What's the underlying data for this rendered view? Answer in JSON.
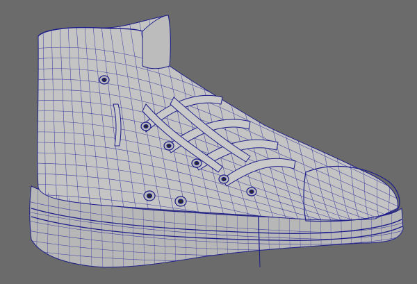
{
  "viewport": {
    "corner_label": "",
    "background_color": "#6b6b6b",
    "model": {
      "name": "sneaker-mesh",
      "shading": "wireframe-on-shaded",
      "surface_color": "#bdbdbd",
      "wire_color": "#1c1c8a"
    }
  }
}
